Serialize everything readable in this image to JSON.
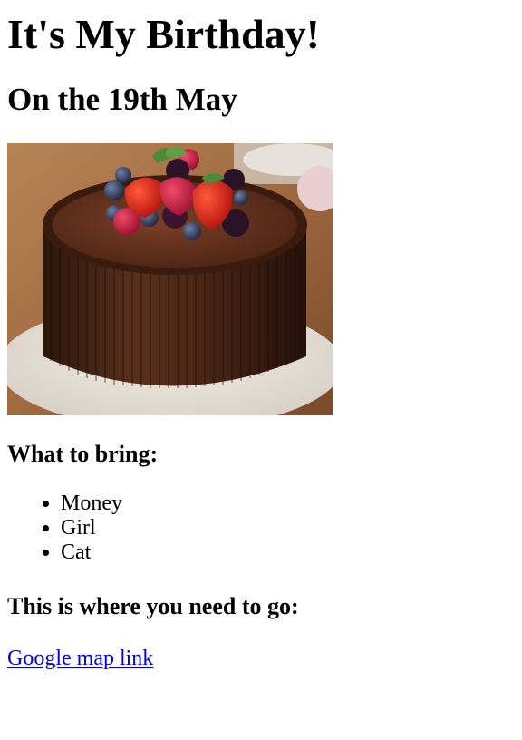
{
  "page": {
    "title": "It's My Birthday!",
    "subtitle": "On the 19th May"
  },
  "bring": {
    "heading": "What to bring:",
    "items": [
      "Money",
      "Girl",
      "Cat"
    ]
  },
  "location": {
    "heading": "This is where you need to go:",
    "link_text": "Google map link"
  },
  "colors": {
    "link": "#0000ee",
    "text": "#000000"
  }
}
